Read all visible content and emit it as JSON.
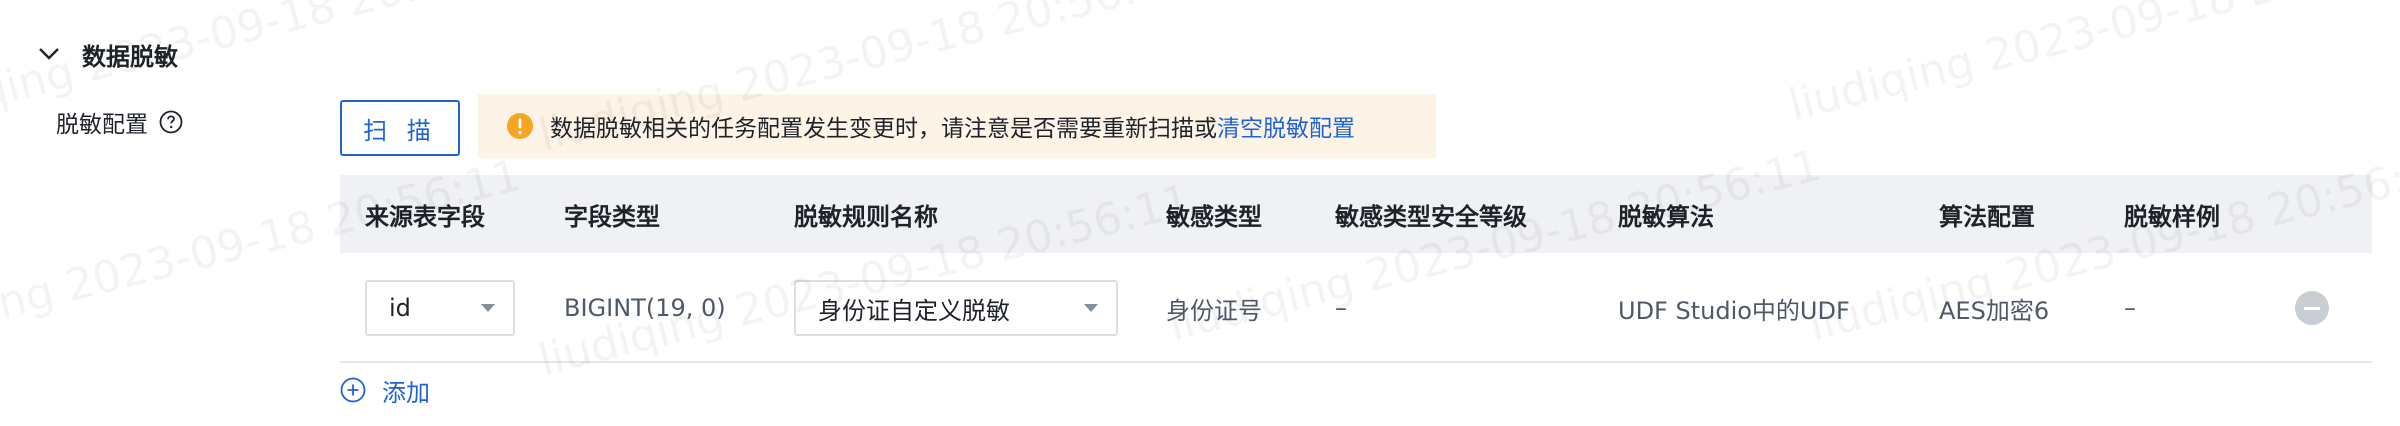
{
  "section": {
    "title": "数据脱敏",
    "collapse_icon": "chevron-down-icon"
  },
  "field": {
    "label": "脱敏配置",
    "help_icon": "question-circle-icon"
  },
  "scan_button": {
    "label": "扫 描"
  },
  "alert": {
    "icon": "warning-circle-icon",
    "text": "数据脱敏相关的任务配置发生变更时，请注意是否需要重新扫描或",
    "link_text": "清空脱敏配置"
  },
  "table": {
    "headers": [
      "来源表字段",
      "字段类型",
      "脱敏规则名称",
      "敏感类型",
      "敏感类型安全等级",
      "脱敏算法",
      "算法配置",
      "脱敏样例"
    ],
    "rows": [
      {
        "source_field": "id",
        "field_type": "BIGINT(19, 0)",
        "rule_name": "身份证自定义脱敏",
        "sensitive_type": "身份证号",
        "security_level": "–",
        "algorithm": "UDF Studio中的UDF",
        "algorithm_config": "AES加密6",
        "sample": "–"
      }
    ]
  },
  "add_button": {
    "label": "添加",
    "icon": "plus-circle-icon"
  },
  "watermark_text": "liudiqing 2023-09-18 20:56:11",
  "colors": {
    "primary": "#1f64d6",
    "alert_bg": "#fdf3e6",
    "warning": "#f5a623",
    "header_bg": "#f0f1f4"
  }
}
